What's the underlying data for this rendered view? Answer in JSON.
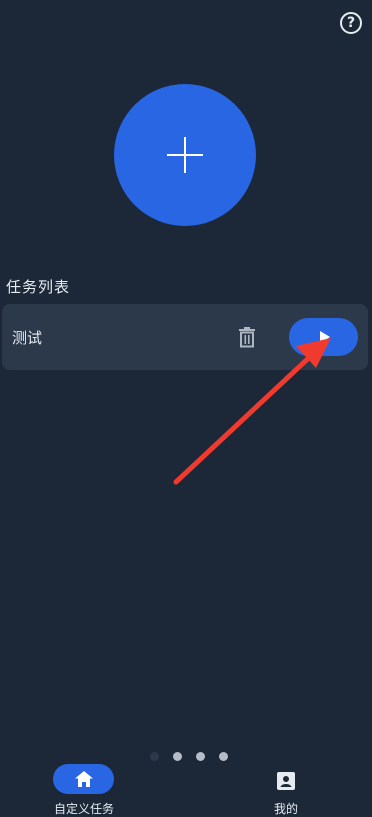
{
  "header": {
    "help_icon": "help-circle-icon",
    "help_glyph": "?"
  },
  "add_task": {
    "icon": "plus-icon"
  },
  "task_list": {
    "title": "任务列表",
    "items": [
      {
        "name": "测试",
        "delete_icon": "trash-icon",
        "run_icon": "play-icon"
      }
    ]
  },
  "annotation": {
    "arrow_color": "#f03a2e"
  },
  "pager": {
    "count": 4,
    "active_index": 0
  },
  "bottom_nav": {
    "items": [
      {
        "label": "自定义任务",
        "icon": "home-icon",
        "active": true
      },
      {
        "label": "我的",
        "icon": "profile-icon",
        "active": false
      }
    ]
  },
  "colors": {
    "background": "#1c2838",
    "card": "#2c394b",
    "accent": "#2866e3",
    "text": "#e6ebf2"
  }
}
